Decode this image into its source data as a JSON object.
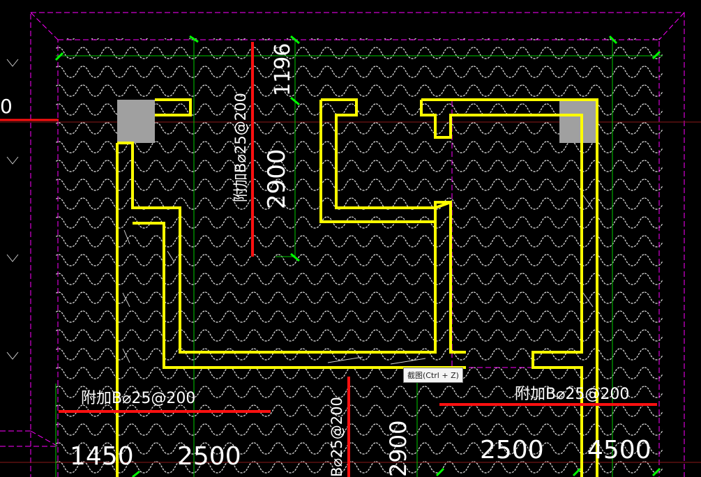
{
  "drawing": {
    "colors": {
      "background": "#000000",
      "wave_hatch": "#d9d9d9",
      "wall_outline": "#ffff00",
      "rebar": "#ff0000",
      "grid_line": "#00ff00",
      "boundary_dash": "#ff00ff",
      "text": "#ffffff",
      "column": "#a0a0a0"
    },
    "edge_label_left": "0",
    "labels": [
      {
        "key": "rebar_label_top",
        "text": "附加B⌀25@200",
        "vertical": true
      },
      {
        "key": "dim_top_upper",
        "text": "1196",
        "vertical": true
      },
      {
        "key": "dim_top_lower",
        "text": "2900",
        "vertical": true
      },
      {
        "key": "rebar_label_left",
        "text": "附加B⌀25@200",
        "vertical": false
      },
      {
        "key": "rebar_label_right",
        "text": "附加B⌀25@200",
        "vertical": false
      },
      {
        "key": "rebar_label_bottom",
        "text": "B⌀25@200",
        "vertical": true
      },
      {
        "key": "dim_bottom_mid",
        "text": "2900",
        "vertical": true
      },
      {
        "key": "dim_1450",
        "text": "1450",
        "vertical": false
      },
      {
        "key": "dim_2500_left",
        "text": "2500",
        "vertical": false
      },
      {
        "key": "dim_2500_right",
        "text": "2500",
        "vertical": false
      },
      {
        "key": "dim_4500",
        "text": "4500",
        "vertical": false
      }
    ]
  },
  "tooltip": {
    "text": "截图(Ctrl + Z)"
  }
}
